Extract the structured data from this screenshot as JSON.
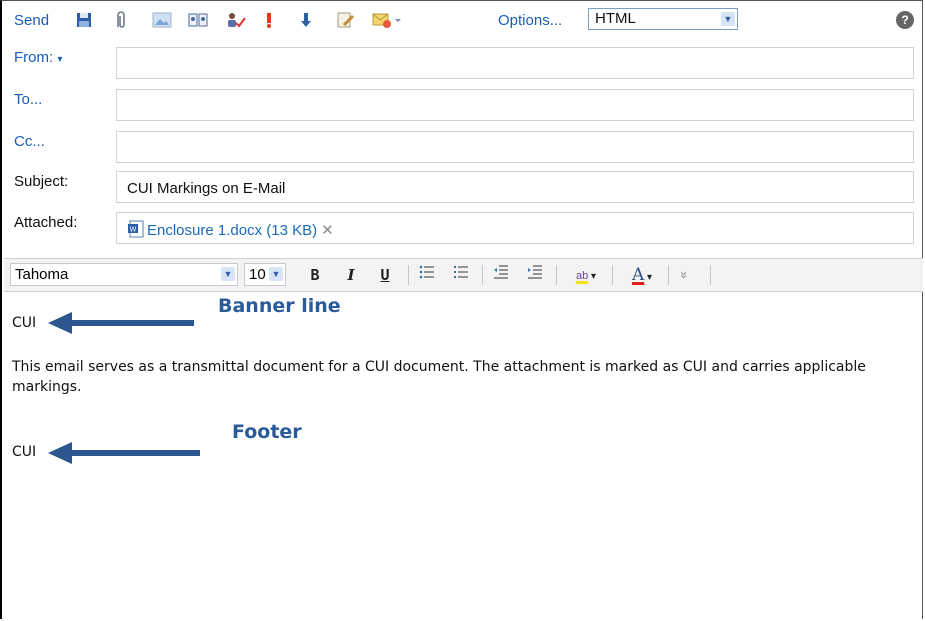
{
  "toolbar": {
    "send_label": "Send",
    "options_label": "Options...",
    "format_value": "HTML",
    "help_label": "?",
    "icons": [
      "save-icon",
      "attach-icon",
      "insert-image-icon",
      "address-book-icon",
      "check-names-icon",
      "high-importance-icon",
      "low-importance-icon",
      "signature-icon",
      "request-receipt-icon"
    ]
  },
  "header": {
    "from_label": "From:",
    "from_value": "",
    "to_label": "To...",
    "to_value": "",
    "cc_label": "Cc...",
    "cc_value": "",
    "subject_label": "Subject:",
    "subject_value": "CUI Markings on E-Mail",
    "attached_label": "Attached:",
    "attachment_name": "Enclosure 1.docx (13 KB)",
    "attachment_remove": "✕"
  },
  "format_bar": {
    "font": "Tahoma",
    "size": "10",
    "bold": "B",
    "italic": "I",
    "underline": "U",
    "highlight_label": "ab",
    "font_color_label": "A",
    "more": "»"
  },
  "message": {
    "banner": "CUI",
    "body": "This email serves as a transmittal document for a CUI document.  The attachment is marked as CUI and carries applicable markings.",
    "footer": "CUI"
  },
  "annotations": {
    "banner_label": "Banner line",
    "footer_label": "Footer"
  },
  "colors": {
    "link_blue": "#1a5cb8",
    "annotation_blue": "#2a5a9a",
    "arrow_blue": "#2b568f"
  }
}
